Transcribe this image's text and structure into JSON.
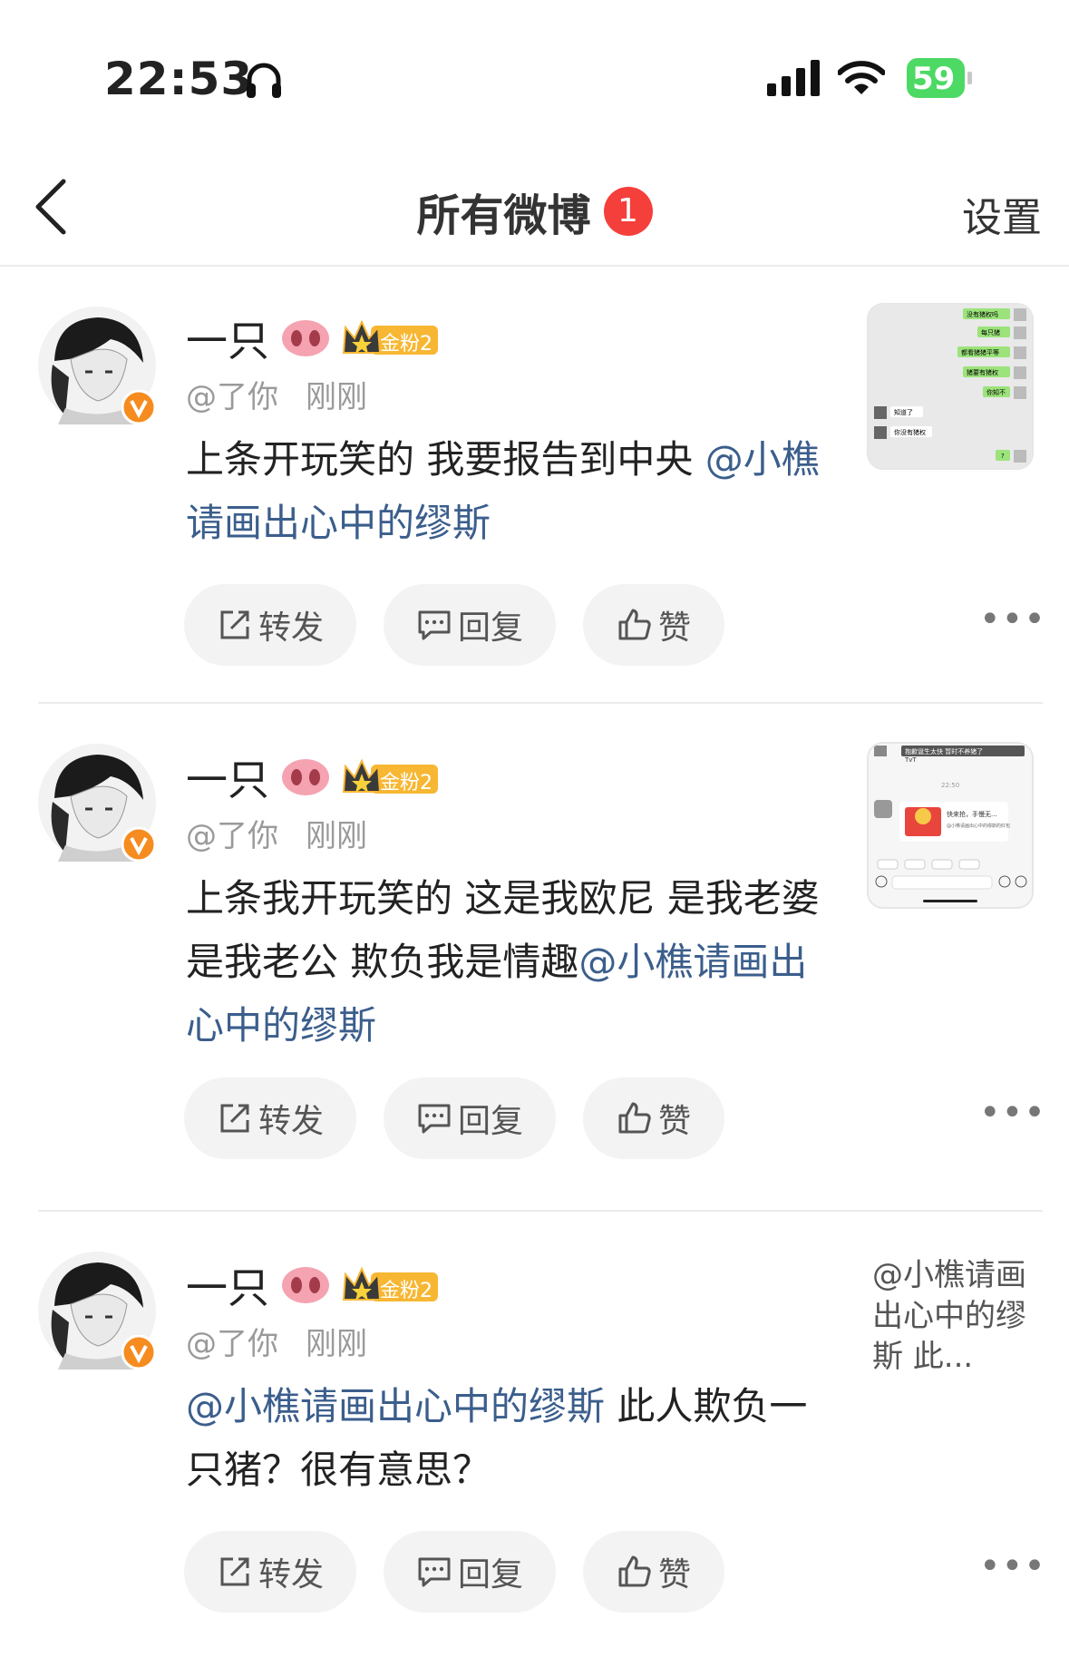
{
  "status_bar": {
    "time": "22:53",
    "battery": "59"
  },
  "nav": {
    "title": "所有微博",
    "badge": "1",
    "settings_label": "设置"
  },
  "actions": {
    "repost": "转发",
    "reply": "回复",
    "like": "赞"
  },
  "posts": [
    {
      "name": "一只",
      "fan_badge": "金粉2",
      "handle": "@了你",
      "time": "刚刚",
      "text": "上条开玩笑的 我要报告到中央",
      "mention": "@小樵请画出心中的缪斯",
      "thumb_messages": [
        "没有猪权吗",
        "每只猪",
        "都看猪猪平等",
        "猪要有猪权",
        "你知不",
        "知道了",
        "你没有猪权"
      ]
    },
    {
      "name": "一只",
      "fan_badge": "金粉2",
      "handle": "@了你",
      "time": "刚刚",
      "text": "上条我开玩笑的 这是我欧尼 是我老婆 是我老公 欺负我是情趣",
      "mention": "@小樵请画出心中的缪斯",
      "thumb_messages": [
        "抱歉诞生太快 暂时不养猪了",
        "TvT",
        "22:50",
        "快来抢，手慢无...",
        "@小樵请画出心中的缪斯的红包"
      ]
    },
    {
      "name": "一只",
      "fan_badge": "金粉2",
      "handle": "@了你",
      "time": "刚刚",
      "mention": "@小樵请画出心中的缪斯",
      "text": " 此人欺负一只猪？很有意思？",
      "side_text": "@小樵请画出心中的缪斯 此..."
    }
  ]
}
